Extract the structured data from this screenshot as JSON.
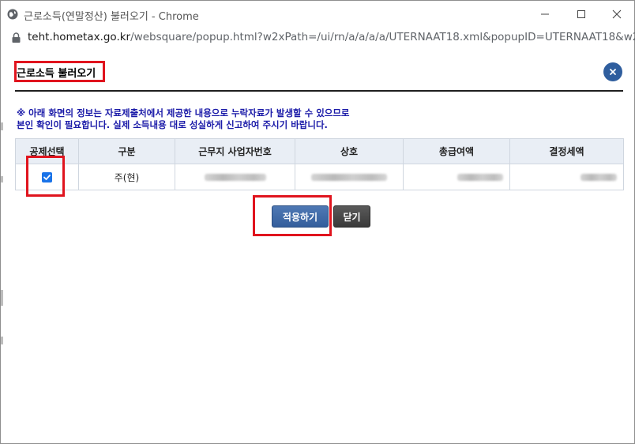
{
  "window": {
    "title": "근로소득(연말정산) 불러오기 - Chrome",
    "controls": {
      "minimize": "minimize-icon",
      "maximize": "maximize-icon",
      "close": "close-icon"
    }
  },
  "address_bar": {
    "host": "teht.hometax.go.kr",
    "path": "/websquare/popup.html?w2xPath=/ui/rn/a/a/a/a/UTERNAAT18.xml&popupID=UTERNAAT18&w2x..."
  },
  "popup": {
    "title": "근로소득 불러오기",
    "close_icon": "close-icon",
    "notice_line1": "※ 아래 화면의 정보는 자료제출처에서 제공한 내용으로 누락자료가 발생할 수 있으므로",
    "notice_line2": "본인 확인이 필요합니다. 실제 소득내용 대로 성실하게 신고하여 주시기 바랍니다."
  },
  "table": {
    "columns": [
      "공제선택",
      "구분",
      "근무지 사업자번호",
      "상호",
      "총급여액",
      "결정세액"
    ],
    "rows": [
      {
        "checked": true,
        "category": "주(현)",
        "business_number": "",
        "company_name": "",
        "total_salary": "",
        "determined_tax": ""
      }
    ]
  },
  "buttons": {
    "apply": "적용하기",
    "close": "닫기"
  },
  "colors": {
    "accent_blue": "#2f5e9e",
    "notice_blue": "#1a1aa8",
    "highlight_red": "#e0141e",
    "checkbox_blue": "#1a73e8"
  }
}
